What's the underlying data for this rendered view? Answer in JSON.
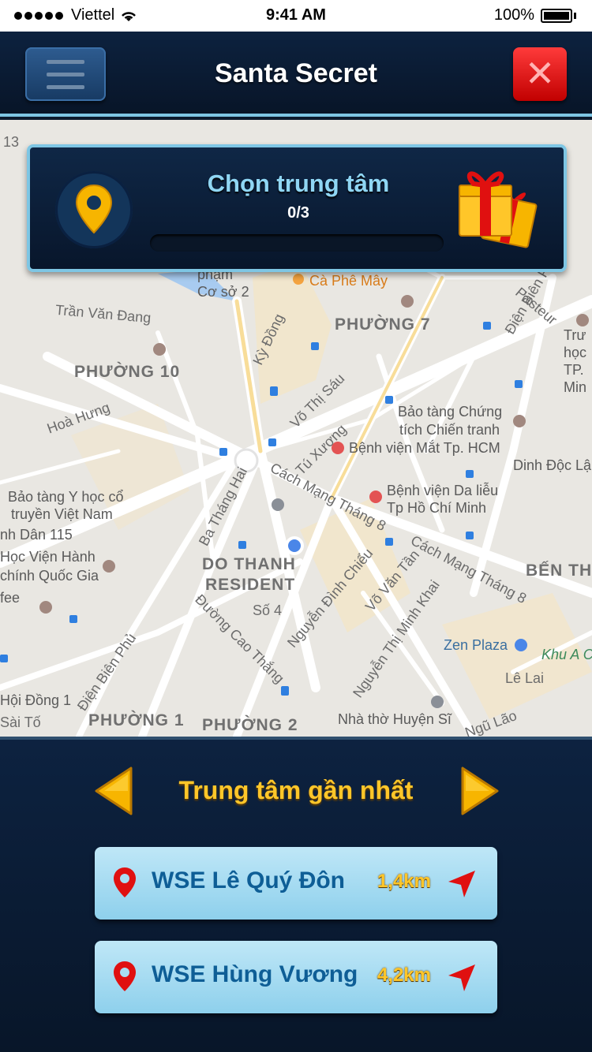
{
  "status_bar": {
    "carrier": "Viettel",
    "time": "9:41 AM",
    "battery": "100%"
  },
  "header": {
    "title": "Santa Secret",
    "menu_icon": "hamburger-icon",
    "close_icon": "close-icon",
    "close_glyph": "✕"
  },
  "map": {
    "labels": {
      "l1": "13",
      "l2": "Cà Phê Mây",
      "l3": "phạm",
      "l4": "Cơ sở 2",
      "l5": "Trần Văn Đang",
      "l6": "PHƯỜNG 7",
      "l7": "PHƯỜNG 10",
      "l8": "Kỳ Đồng",
      "l9": "Hoà Hưng",
      "l10": "Võ Thị Sáu",
      "l11": "Bảo tàng Chứng",
      "l12": "tích Chiến tranh",
      "l13": "Bệnh viện Mắt Tp. HCM",
      "l14": "Tú Xương",
      "l15": "Dinh Độc Lập",
      "l16": "Bệnh viện Da liễu",
      "l17": "Tp Hồ Chí Minh",
      "l18": "Bảo tàng Y học cổ",
      "l19": "truyền Việt Nam",
      "l20": "Cách Mạng Tháng 8",
      "l21": "Ba Tháng Hai",
      "l22": "nh Dân 115",
      "l23": "Học Viện Hành",
      "l24": "chính Quốc Gia",
      "l25": "DO THANH",
      "l26": "RESIDENT",
      "l27": "BẾN THÀNH",
      "l28": "Cách Mạng Tháng 8",
      "l29": "Số 4",
      "l30": "Zen Plaza",
      "l31": "Khu A C",
      "l32": "Lê Lai",
      "l33": "Nhà thờ Huyện Sĩ",
      "l34": "PHƯỜNG 1",
      "l35": "PHƯỜNG 2",
      "l36": "Hội Đồng 1",
      "l37": "Sài Tố",
      "l38": "Pasteur",
      "l39": "Điện Biên Phủ",
      "l40": "Nguyễn Đình Chiểu",
      "l41": "Võ Văn Tần",
      "l42": "Đường Cao Thắng",
      "l43": "Nguyễn Thị Minh Khai",
      "l44": "Trư học TP. Min",
      "l45": "fee",
      "l46": "Ngũ Lão",
      "l47": "Điện Biên Phủ"
    }
  },
  "mission": {
    "title": "Chọn trung tâm",
    "count": "0/3",
    "progress": 0,
    "pin_icon": "location-pin-icon",
    "reward_icon": "gift-box-icon"
  },
  "nearest": {
    "title": "Trung tâm gần nhất",
    "prev_icon": "arrow-left-icon",
    "next_icon": "arrow-right-icon",
    "centers": [
      {
        "name": "WSE Lê Quý Đôn",
        "distance": "1,4km"
      },
      {
        "name": "WSE Hùng Vương",
        "distance": "4,2km"
      }
    ]
  },
  "colors": {
    "accent_blue": "#7ec6e4",
    "title_yellow": "#ffc629",
    "close_red": "#e01010",
    "card_blue": "#8ed0ec"
  }
}
